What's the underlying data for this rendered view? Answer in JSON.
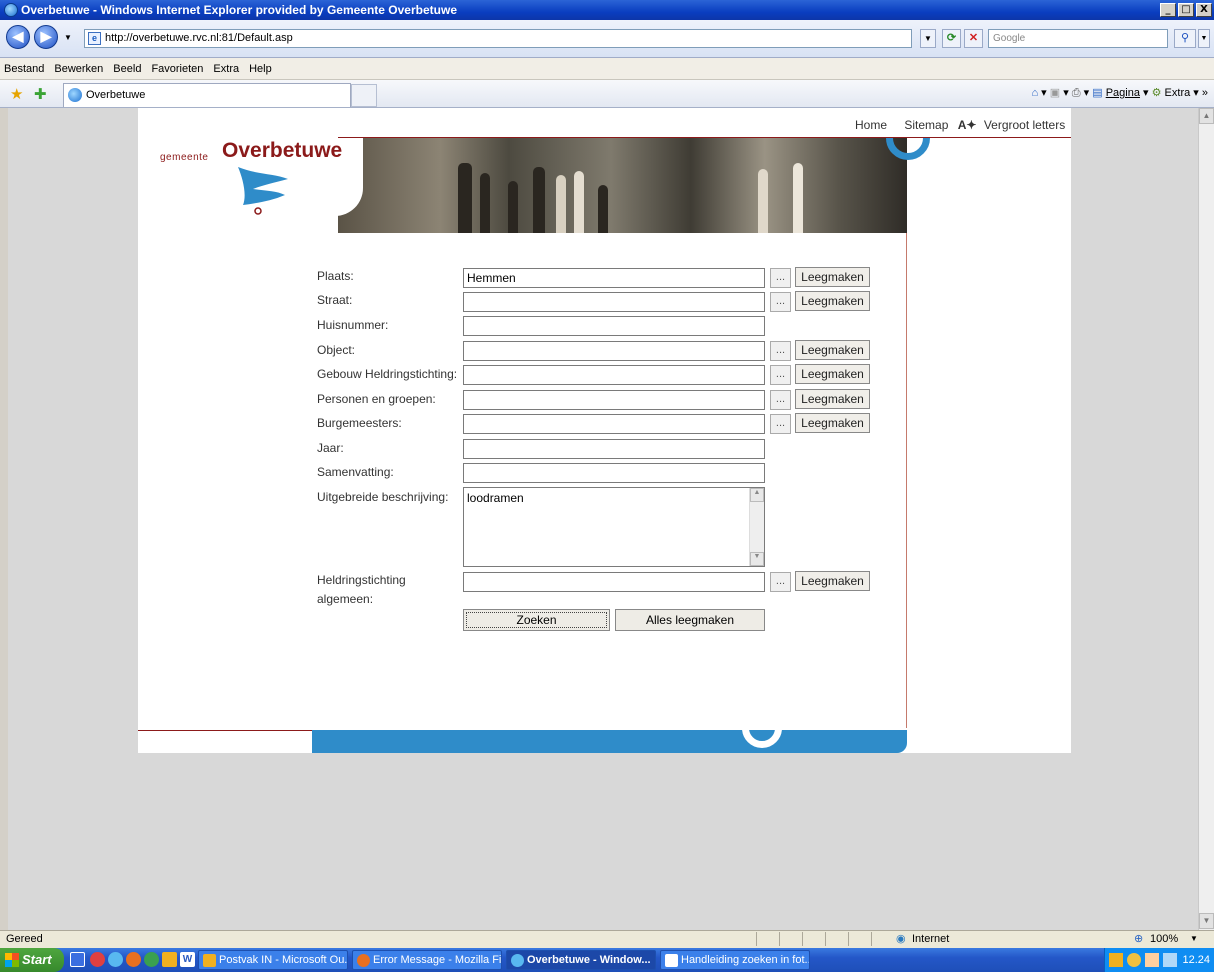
{
  "window": {
    "title": "Overbetuwe - Windows Internet Explorer provided by Gemeente Overbetuwe",
    "min": "_",
    "max": "□",
    "close": "X"
  },
  "address": {
    "url": "http://overbetuwe.rvc.nl:81/Default.asp",
    "search_placeholder": "Google"
  },
  "menu": [
    "Bestand",
    "Bewerken",
    "Beeld",
    "Favorieten",
    "Extra",
    "Help"
  ],
  "tab": {
    "label": "Overbetuwe"
  },
  "commands": {
    "pagina": "Pagina",
    "extra": "Extra"
  },
  "site": {
    "logo_small": "gemeente",
    "logo_big": "Overbetuwe",
    "top_links": {
      "home": "Home",
      "sitemap": "Sitemap",
      "font_icon": "A✦",
      "vergroot": "Vergroot letters"
    }
  },
  "form": {
    "fields": [
      {
        "label": "Plaats:",
        "value": "Hemmen",
        "lookup": true
      },
      {
        "label": "Straat:",
        "value": "",
        "lookup": true
      },
      {
        "label": "Huisnummer:",
        "value": "",
        "lookup": false
      },
      {
        "label": "Object:",
        "value": "",
        "lookup": true
      },
      {
        "label": "Gebouw Heldringstichting:",
        "value": "",
        "lookup": true
      },
      {
        "label": "Personen en groepen:",
        "value": "",
        "lookup": true
      },
      {
        "label": "Burgemeesters:",
        "value": "",
        "lookup": true
      },
      {
        "label": "Jaar:",
        "value": "",
        "lookup": false
      },
      {
        "label": "Samenvatting:",
        "value": "",
        "lookup": false
      }
    ],
    "uitgebreid": {
      "label": "Uitgebreide beschrijving:",
      "value": "loodramen"
    },
    "heldring": {
      "label_line1": "Heldringstichting",
      "label_line2": "algemeen:",
      "value": ""
    },
    "dots_label": "...",
    "clear_label": "Leegmaken",
    "search_label": "Zoeken",
    "clear_all_label": "Alles leegmaken"
  },
  "status": {
    "text": "Gereed",
    "zone": "Internet",
    "zoom": "100%"
  },
  "taskbar": {
    "start": "Start",
    "tasks": [
      "Postvak IN - Microsoft Ou...",
      "Error Message - Mozilla Fi...",
      "Overbetuwe - Window...",
      "Handleiding zoeken in fot..."
    ],
    "clock": "12.24"
  },
  "colors": {
    "brand": "#8b1a1a",
    "accent_blue": "#2f8cc9",
    "title_blue": "#0a3ec0"
  }
}
